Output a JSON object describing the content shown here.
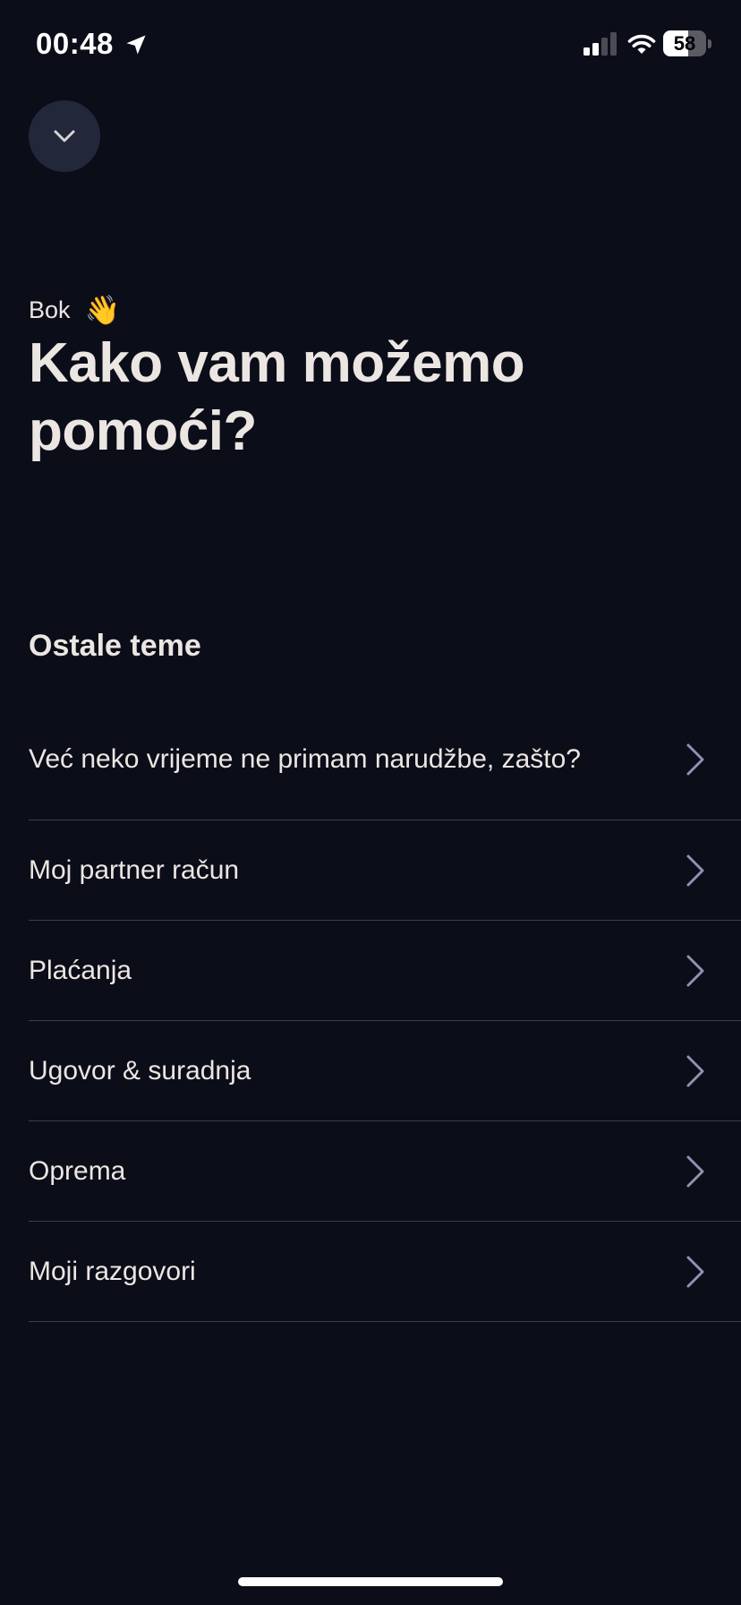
{
  "status_bar": {
    "time": "00:48",
    "battery_percent": "58",
    "battery_level": 0.58
  },
  "icons": {
    "collapse": "chevron-down-icon",
    "topic_arrow": "chevron-right-icon",
    "location": "location-arrow-icon",
    "signal": "cellular-signal-icon",
    "wifi": "wifi-icon",
    "wave": "waving-hand-icon"
  },
  "colors": {
    "background": "#0b0d19",
    "text": "#ece6e2",
    "button_bg": "#23273a",
    "chevron": "#8e93b0",
    "divider": "#3a3e54"
  },
  "greeting": {
    "text": "Bok",
    "emoji": "👋"
  },
  "title": "Kako vam možemo pomoći?",
  "topics": {
    "section_title": "Ostale teme",
    "items": [
      {
        "label": "Već neko vrijeme ne primam narudžbe, zašto?"
      },
      {
        "label": "Moj partner račun"
      },
      {
        "label": "Plaćanja"
      },
      {
        "label": "Ugovor & suradnja"
      },
      {
        "label": "Oprema"
      },
      {
        "label": "Moji razgovori"
      }
    ]
  }
}
